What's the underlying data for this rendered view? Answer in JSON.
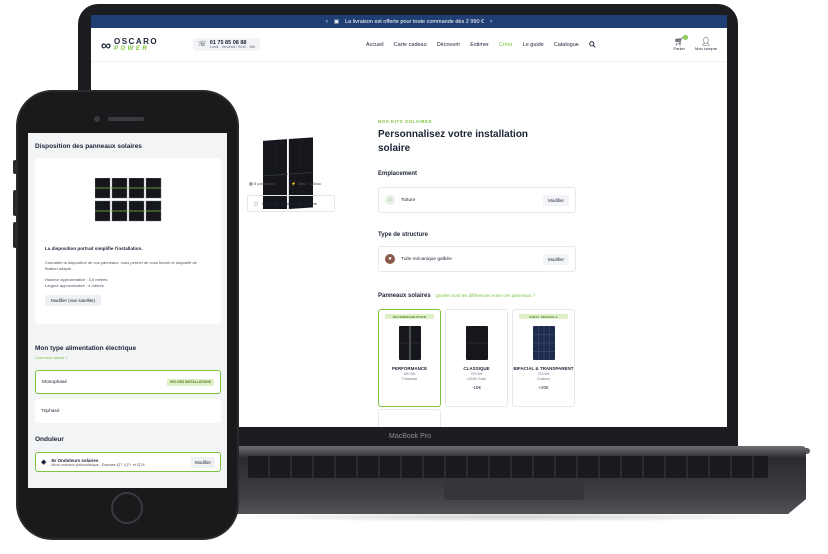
{
  "laptop": {
    "brand_label": "MacBook Pro",
    "announce": {
      "text": "La livraison est offerte pour toute commande dès 2 990 €",
      "prev": "‹",
      "next": "›"
    },
    "header": {
      "logo_top": "OSCARO",
      "logo_bottom": "POWER",
      "phone_number": "01 75 85 08 88",
      "phone_hours": "Lundi - Vendredi / 9h30 - 18h",
      "nav": [
        "Accueil",
        "Carte cadeau",
        "Découvrir",
        "Estimer",
        "Créer",
        "Le guide",
        "Catalogue"
      ],
      "nav_active_index": 4,
      "cart_label": "Panier",
      "cart_count": "0",
      "account_label": "Mon compte"
    },
    "product": {
      "panel_count": "8 panneaux",
      "total_power": "Total : 3,2kwc",
      "compose_label": "Voir la composition du système",
      "kicker": "NOS KITS SOLAIRES",
      "title": "Personnalisez votre installation solaire",
      "emplacement_heading": "Emplacement",
      "emplacement_value": "Toiture",
      "structure_heading": "Type de structure",
      "structure_value": "Tuile mécanique galbée",
      "modify_label": "Modifier",
      "panels_heading": "Panneaux solaires",
      "panels_hint": "Quelles sont les différences entre ces panneaux ?",
      "cards": [
        {
          "badge": "RECOMMANDATION",
          "name": "PERFORMANCE",
          "spec1": "400 Wc",
          "spec2": "Trinasolar",
          "price": "",
          "selected": true
        },
        {
          "badge": "",
          "name": "CLASSIQUE",
          "spec1": "375 Wc",
          "spec2": "LONGi Solar",
          "price": "-16€",
          "selected": false
        },
        {
          "badge": "IDÉAL PERGOLA",
          "name": "BIFACIAL & TRANSPARENT",
          "spec1": "375 Wc",
          "spec2": "Dualsun",
          "price": "+20€",
          "selected": false
        }
      ]
    }
  },
  "phone": {
    "layout_heading": "Disposition des panneaux solaires",
    "layout_caption": "La disposition portrait simplifie l'installation.",
    "layout_desc": "Connaître la disposition de vos panneaux, nous permet de vous fournir le dispositif de fixation adapté.",
    "height_line": "Hauteur approximative : 3,5 mètres",
    "width_line": "Largeur approximative : 4 mètres",
    "modify_satellite": "Modifier (vue satellite)",
    "power_heading": "Mon type alimentation électrique",
    "power_hint": "Comment savoir ?",
    "option_mono": "Monophasé",
    "option_mono_tag": "90% DES INSTALLATIONS",
    "option_tri": "Triphasé",
    "inverter_heading": "Onduleur",
    "inverter_name": "8x Onduleurs solaires",
    "inverter_desc": "Micro-onduleur photovoltaïque - Enphase IQ7, IQ7+ et IQ7A",
    "inverter_modify": "Modifier"
  },
  "colors": {
    "accent_green": "#7dc33f",
    "navy": "#1b2436",
    "announce_bar": "#1f3f74"
  }
}
